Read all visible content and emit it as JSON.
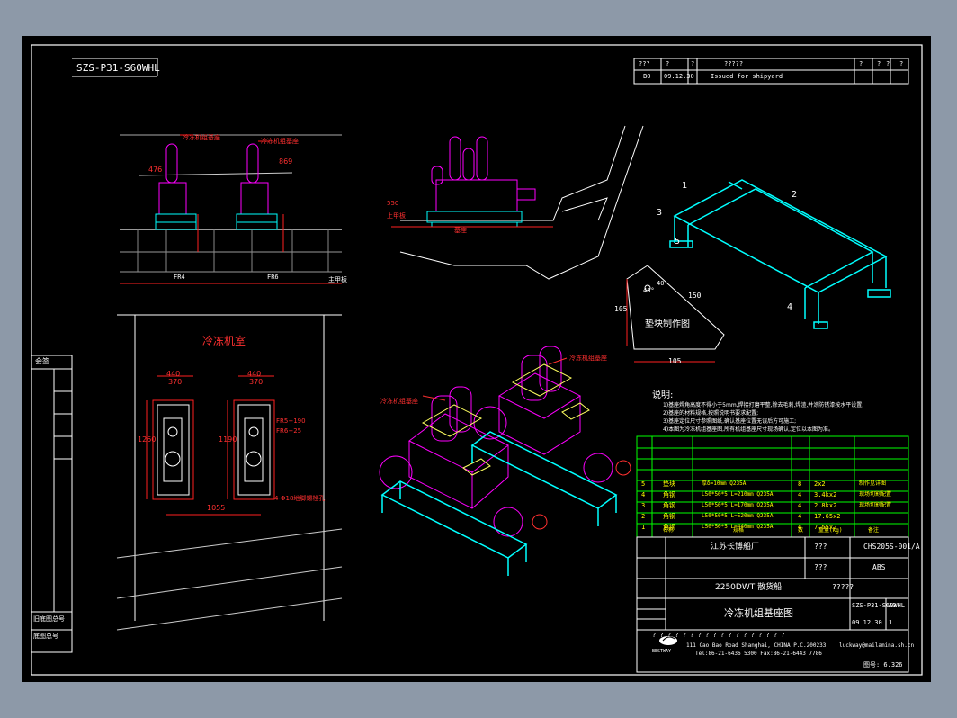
{
  "drawing_code": "SZS-P31-S60WHL",
  "revision": {
    "header": [
      "???",
      "?",
      "?",
      "?????",
      "?",
      "?",
      "?",
      "?"
    ],
    "row": {
      "no": "B0",
      "date": "09.12.30",
      "desc": "Issued for shipyard"
    }
  },
  "elevation_view": {
    "callout_left": "冷冻机组基座",
    "callout_right": "冷冻机组基座",
    "dim_left": "476",
    "dim_right": "869",
    "frame_left": "FR4",
    "frame_right": "FR6",
    "deck_label": "主甲板"
  },
  "side_view": {
    "label_a": "550",
    "label_b": "上甲板",
    "label_c": "基座"
  },
  "plan_view": {
    "title": "冷冻机室",
    "dims_top": [
      "440",
      "440",
      "370",
      "370"
    ],
    "dims_side": [
      "1260",
      "1190"
    ],
    "dim_bottom": "1055",
    "note_1": "FR5+190",
    "note_2": "FR6+25",
    "note_3": "4-Φ18地脚螺栓孔"
  },
  "pad_detail": {
    "title": "垫块制作图",
    "dims": [
      "40",
      "105",
      "105",
      "150"
    ],
    "angle": "45°"
  },
  "iso_labels": [
    "1",
    "2",
    "3",
    "4",
    "5"
  ],
  "iso_callouts": [
    "冷冻机组基座",
    "冷冻机组基座"
  ],
  "notes": {
    "title": "说明:",
    "lines": [
      "1)基座焊角高度不得小于5mm,焊接打磨平整,除去毛刺,焊渣,并涂防锈漆按水平设置;",
      "2)基座的材料规格,按照说明书要求配置;",
      "3)基座定位尺寸参照图纸,确认基座位置无误后方可施工;",
      "4)本图为冷冻机组基座图,所有机组基座尺寸现场确认,定位以本图为准。"
    ]
  },
  "bom": {
    "rows": [
      {
        "no": "5",
        "name": "垫块",
        "spec": "厚δ=10mm Q235A",
        "qty": "8",
        "weight": "2x2",
        "remark": "制作见详图"
      },
      {
        "no": "4",
        "name": "角钢",
        "spec": "L50*50*5 L=210mm Q235A",
        "qty": "4",
        "weight": "3.4kx2",
        "remark": "现场切割配置"
      },
      {
        "no": "3",
        "name": "角钢",
        "spec": "L50*50*5 L=170mm Q235A",
        "qty": "4",
        "weight": "2.8kx2",
        "remark": "现场切割配置"
      },
      {
        "no": "2",
        "name": "角钢",
        "spec": "L50*50*5 L=520mm Q235A",
        "qty": "4",
        "weight": "17.65x2",
        "remark": ""
      },
      {
        "no": "1",
        "name": "角钢",
        "spec": "L50*50*5 L=440mm Q235A",
        "qty": "4",
        "weight": "7.55x2",
        "remark": ""
      }
    ],
    "header": [
      "序",
      "名称",
      "规格",
      "数",
      "重量(kg)",
      "备注"
    ]
  },
  "title_block": {
    "company": "江苏长博船厂",
    "class_label": "???",
    "class_value": "ABS",
    "ship": "2250DWT 散货船",
    "drawing_title": "冷冻机组基座图",
    "doc_no": "CHS205S-001/A",
    "drawing_no": "SZS-P31-S60WHL",
    "date": "09.12.30",
    "scale_row": "?????",
    "qmarks": "? ? ? ? ? ? ? ? ? ? ? ? ? ? ? ? ? ?",
    "sheet": "A3",
    "page": "1",
    "qq": "???"
  },
  "company_block": {
    "logo_text": "BESTWAY",
    "address": "111 Cao Bao Road Shanghai, CHINA   P.C.200233",
    "contact": "Tel:86-21-6436 5300  Fax:86-21-6443 7786",
    "email": "luckway@mailamina.sh.cn"
  },
  "left_strip": [
    "会签",
    "旧底图总号",
    "底图总号"
  ],
  "scale_footer": "图号: 6.326"
}
